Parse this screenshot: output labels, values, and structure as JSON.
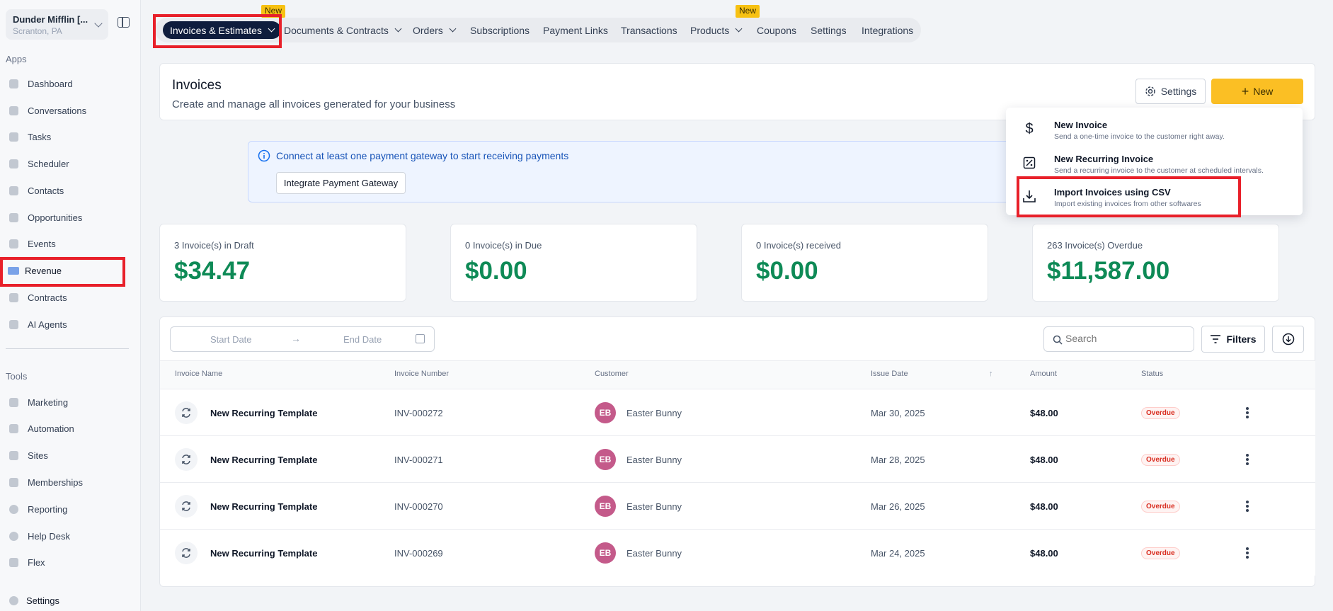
{
  "location": {
    "name": "Dunder Mifflin [...",
    "sub": "Scranton, PA"
  },
  "sidebar": {
    "apps_title": "Apps",
    "apps": [
      {
        "label": "Dashboard"
      },
      {
        "label": "Conversations"
      },
      {
        "label": "Tasks"
      },
      {
        "label": "Scheduler"
      },
      {
        "label": "Contacts"
      },
      {
        "label": "Opportunities"
      },
      {
        "label": "Events"
      },
      {
        "label": "Revenue"
      },
      {
        "label": "Contracts"
      },
      {
        "label": "AI Agents"
      }
    ],
    "tools_title": "Tools",
    "tools": [
      {
        "label": "Marketing"
      },
      {
        "label": "Automation"
      },
      {
        "label": "Sites"
      },
      {
        "label": "Memberships"
      },
      {
        "label": "Reporting"
      },
      {
        "label": "Help Desk"
      },
      {
        "label": "Flex"
      }
    ],
    "settings": "Settings"
  },
  "tabs": [
    {
      "label": "Invoices & Estimates"
    },
    {
      "label": "Documents & Contracts"
    },
    {
      "label": "Orders"
    },
    {
      "label": "Subscriptions"
    },
    {
      "label": "Payment Links"
    },
    {
      "label": "Transactions"
    },
    {
      "label": "Products"
    },
    {
      "label": "Coupons"
    },
    {
      "label": "Settings"
    },
    {
      "label": "Integrations"
    }
  ],
  "badge_new": "New",
  "header": {
    "title": "Invoices",
    "subtitle": "Create and manage all invoices generated for your business",
    "settings_btn": "Settings",
    "new_btn": "New"
  },
  "banner": {
    "text": "Connect at least one payment gateway to start receiving payments",
    "button": "Integrate Payment Gateway"
  },
  "dropdown": [
    {
      "title": "New Invoice",
      "desc": "Send a one-time invoice to the customer right away."
    },
    {
      "title": "New Recurring Invoice",
      "desc": "Send a recurring invoice to the customer at scheduled intervals."
    },
    {
      "title": "Import Invoices using CSV",
      "desc": "Import existing invoices from other softwares"
    }
  ],
  "stats": [
    {
      "label": "3 Invoice(s) in Draft",
      "value": "$34.47"
    },
    {
      "label": "0 Invoice(s) in Due",
      "value": "$0.00"
    },
    {
      "label": "0 Invoice(s) received",
      "value": "$0.00"
    },
    {
      "label": "263 Invoice(s) Overdue",
      "value": "$11,587.00"
    }
  ],
  "filters": {
    "start": "Start Date",
    "end": "End Date",
    "search_placeholder": "Search",
    "filters_btn": "Filters"
  },
  "table": {
    "headers": [
      "Invoice Name",
      "Invoice Number",
      "Customer",
      "Issue Date",
      "Amount",
      "Status"
    ],
    "rows": [
      {
        "name": "New Recurring Template",
        "number": "INV-000272",
        "initials": "EB",
        "customer": "Easter Bunny",
        "date": "Mar 30, 2025",
        "amount": "$48.00",
        "status": "Overdue"
      },
      {
        "name": "New Recurring Template",
        "number": "INV-000271",
        "initials": "EB",
        "customer": "Easter Bunny",
        "date": "Mar 28, 2025",
        "amount": "$48.00",
        "status": "Overdue"
      },
      {
        "name": "New Recurring Template",
        "number": "INV-000270",
        "initials": "EB",
        "customer": "Easter Bunny",
        "date": "Mar 26, 2025",
        "amount": "$48.00",
        "status": "Overdue"
      },
      {
        "name": "New Recurring Template",
        "number": "INV-000269",
        "initials": "EB",
        "customer": "Easter Bunny",
        "date": "Mar 24, 2025",
        "amount": "$48.00",
        "status": "Overdue"
      }
    ]
  },
  "colors": {
    "accent": "#fbbf24",
    "active_tab": "#0f1d3d",
    "money": "#0e8a56",
    "highlight": "#e8202a"
  }
}
